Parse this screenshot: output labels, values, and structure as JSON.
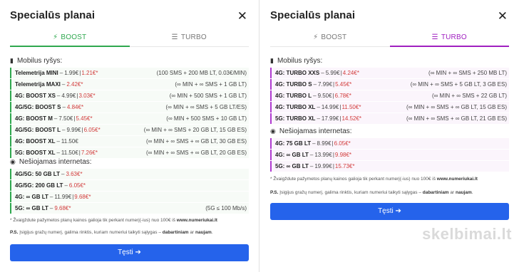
{
  "left": {
    "title": "Specialūs planai",
    "tabs": [
      {
        "label": "BOOST",
        "icon": "⚡"
      },
      {
        "label": "TURBO",
        "icon": "☰"
      }
    ],
    "section_mobile": "Mobilus ryšys:",
    "mobile_rows": [
      {
        "name": "Telemetrija MINI",
        "price": "1.99€",
        "promo": "1.21€*",
        "detail": "(100 SMS + 200 MB LT, 0.03€/MIN)"
      },
      {
        "name": "Telemetrija MAXI",
        "price": "2.42€*",
        "promo": "",
        "detail": "(∞ MIN + ∞ SMS + 1 GB LT)"
      },
      {
        "name": "4G: BOOST XS",
        "price": "4.99€",
        "promo": "3.03€*",
        "detail": "(∞ MIN + 500 SMS + 1 GB LT)"
      },
      {
        "name": "4G/5G: BOOST S",
        "price": "4.84€*",
        "promo": "",
        "detail": "(∞ MIN + ∞ SMS + 5 GB LT/ES)"
      },
      {
        "name": "4G: BOOST M",
        "price": "7.50€",
        "promo": "5.45€*",
        "detail": "(∞ MIN + 500 SMS + 10 GB LT)"
      },
      {
        "name": "4G/5G: BOOST L",
        "price": "9.99€",
        "promo": "6.05€*",
        "detail": "(∞ MIN + ∞ SMS + 20 GB LT, 15 GB ES)"
      },
      {
        "name": "4G: BOOST XL",
        "price": "11.50€",
        "promo": "",
        "detail": "(∞ MIN + ∞ SMS + ∞ GB LT, 30 GB ES)"
      },
      {
        "name": "5G: BOOST XL",
        "price": "11.50€",
        "promo": "7.26€*",
        "detail": "(∞ MIN + ∞ SMS + ∞ GB LT, 20 GB ES)"
      }
    ],
    "section_internet": "Nešiojamas internetas:",
    "internet_rows": [
      {
        "name": "4G/5G: 50 GB LT",
        "price": "3.63€*",
        "promo": "",
        "detail": ""
      },
      {
        "name": "4G/5G: 200 GB LT",
        "price": "6.05€*",
        "promo": "",
        "detail": ""
      },
      {
        "name": "4G: ∞ GB LT",
        "price": "11.99€",
        "promo": "9.68€*",
        "detail": ""
      },
      {
        "name": "5G: ∞ GB LT",
        "price": "9.68€*",
        "promo": "",
        "detail": "(5G ≤ 100 Mb/s)"
      }
    ],
    "note_star": "* Žvaigždute pažymetos planų kainos galioja tik perkant numerį(-ius) nuo 100€ iš ",
    "note_site": "www.numeriukai.lt",
    "note_ps_label": "P.S.",
    "note_ps": " Įsigijus gražų numerį, galima rinktis, kuriam numeriui taikyti sąlygas – ",
    "note_now": "dabartiniam",
    "note_or": " ar ",
    "note_new": "naujam",
    "note_end": ".",
    "cta": "Tęsti ➔"
  },
  "right": {
    "title": "Specialūs planai",
    "tabs": [
      {
        "label": "BOOST",
        "icon": "⚡"
      },
      {
        "label": "TURBO",
        "icon": "☰"
      }
    ],
    "section_mobile": "Mobilus ryšys:",
    "mobile_rows": [
      {
        "name": "4G: TURBO XXS",
        "price": "5.99€",
        "promo": "4.24€*",
        "detail": "(∞ MIN + ∞ SMS + 250 MB LT)"
      },
      {
        "name": "4G: TURBO S",
        "price": "7.99€",
        "promo": "5.45€*",
        "detail": "(∞ MIN + ∞ SMS + 5 GB LT, 3 GB ES)"
      },
      {
        "name": "4G: TURBO L",
        "price": "9.50€",
        "promo": "6.78€*",
        "detail": "(∞ MIN + ∞ SMS + 22 GB LT)"
      },
      {
        "name": "4G: TURBO XL",
        "price": "14.99€",
        "promo": "11.50€*",
        "detail": "(∞ MIN + ∞ SMS + ∞ GB LT, 15 GB ES)"
      },
      {
        "name": "5G: TURBO XL",
        "price": "17.99€",
        "promo": "14.52€*",
        "detail": "(∞ MIN + ∞ SMS + ∞ GB LT, 21 GB ES)"
      }
    ],
    "section_internet": "Nešiojamas internetas:",
    "internet_rows": [
      {
        "name": "4G: 75 GB LT",
        "price": "8.99€",
        "promo": "6.05€*",
        "detail": ""
      },
      {
        "name": "4G: ∞ GB LT",
        "price": "13.99€",
        "promo": "9.98€*",
        "detail": ""
      },
      {
        "name": "5G: ∞ GB LT",
        "price": "19.99€",
        "promo": "15.73€*",
        "detail": ""
      }
    ],
    "note_star": "* Žvaigždute pažymetos planų kainos galioja tik perkant numerį(-ius) nuo 100€ iš ",
    "note_site": "www.numeriukai.lt",
    "note_ps_label": "P.S.",
    "note_ps": " Įsigijus gražų numerį, galima rinktis, kuriam numeriui taikyti sąlygas – ",
    "note_now": "dabartiniam",
    "note_or": " ar ",
    "note_new": "naujam",
    "note_end": ".",
    "cta": "Tęsti ➔"
  },
  "watermark": "skelbimai.lt",
  "colors": {
    "green": "#2fa84f",
    "purple": "#a020c0",
    "promo": "#d23c3c",
    "button": "#2563eb"
  }
}
